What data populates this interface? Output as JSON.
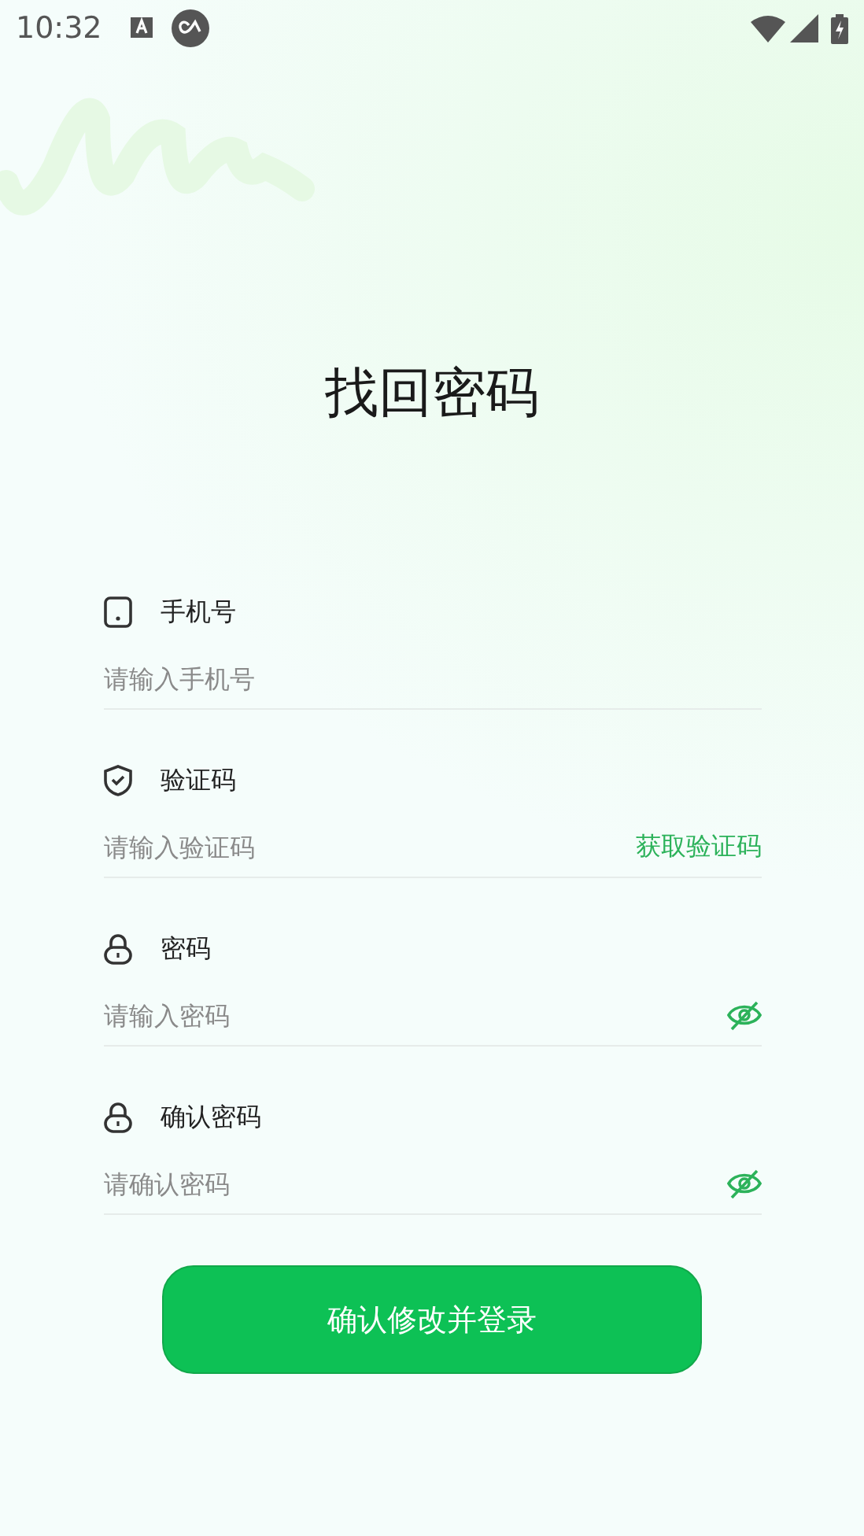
{
  "status_bar": {
    "time": "10:32"
  },
  "title": "找回密码",
  "fields": [
    {
      "kind": "phone",
      "label": "手机号",
      "placeholder": "请输入手机号"
    },
    {
      "kind": "code",
      "label": "验证码",
      "placeholder": "请输入验证码",
      "action": "获取验证码"
    },
    {
      "kind": "password",
      "label": "密码",
      "placeholder": "请输入密码",
      "visible": false
    },
    {
      "kind": "password",
      "label": "确认密码",
      "placeholder": "请确认密码",
      "visible": false
    }
  ],
  "submit_button": "确认修改并登录"
}
